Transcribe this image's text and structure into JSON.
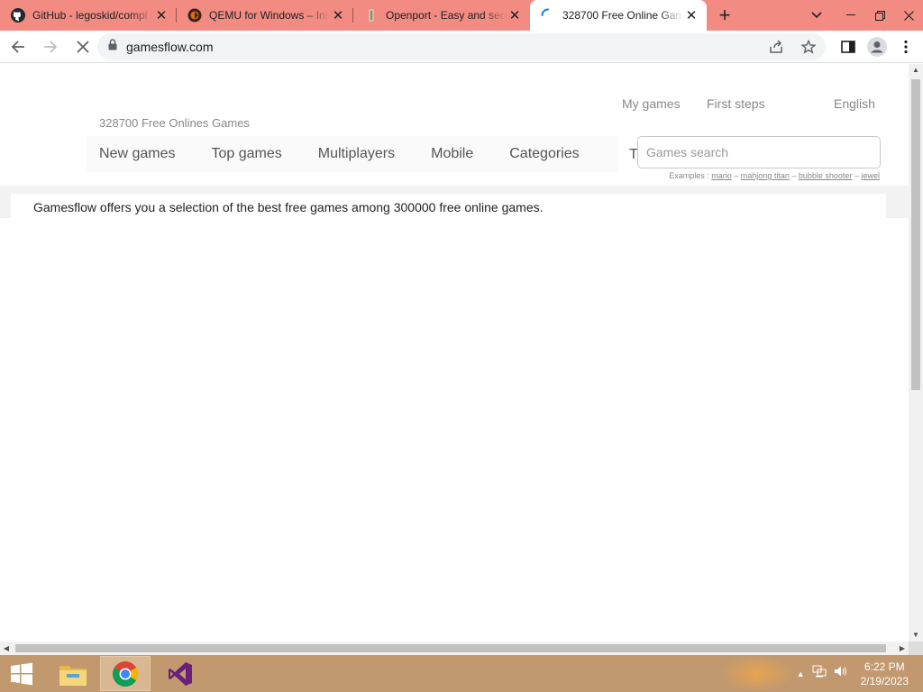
{
  "browser": {
    "tabs": [
      {
        "title": "GitHub - legoskid/compl",
        "icon": "github-icon",
        "active": false
      },
      {
        "title": "QEMU for Windows – Inst",
        "icon": "qemu-icon",
        "active": false
      },
      {
        "title": "Openport - Easy and secu",
        "icon": "openport-icon",
        "active": false
      },
      {
        "title": "328700 Free Online Gam",
        "icon": "loading-spinner-icon",
        "active": true
      }
    ],
    "new_tab_label": "+",
    "url": "gamesflow.com"
  },
  "site": {
    "top_links": {
      "my_games": "My games",
      "first_steps": "First steps",
      "language": "English"
    },
    "subtitle": "328700 Free Onlines Games",
    "nav": {
      "new_games": "New games",
      "top_games": "Top games",
      "multiplayers": "Multiplayers",
      "mobile": "Mobile",
      "categories": "Categories",
      "truncated": "T"
    },
    "search": {
      "placeholder": "Games search",
      "examples_prefix": "Examples :",
      "examples": [
        "mario",
        "mahjong titan",
        "bubble shooter",
        "jewel"
      ],
      "separator": "–"
    },
    "intro": "Gamesflow offers you a selection of the best free games among 300000 free online games."
  },
  "taskbar": {
    "time": "6:22 PM",
    "date": "2/19/2023"
  },
  "colors": {
    "tabbar_bg": "#f28b82",
    "taskbar_bg": "#c2996f"
  }
}
